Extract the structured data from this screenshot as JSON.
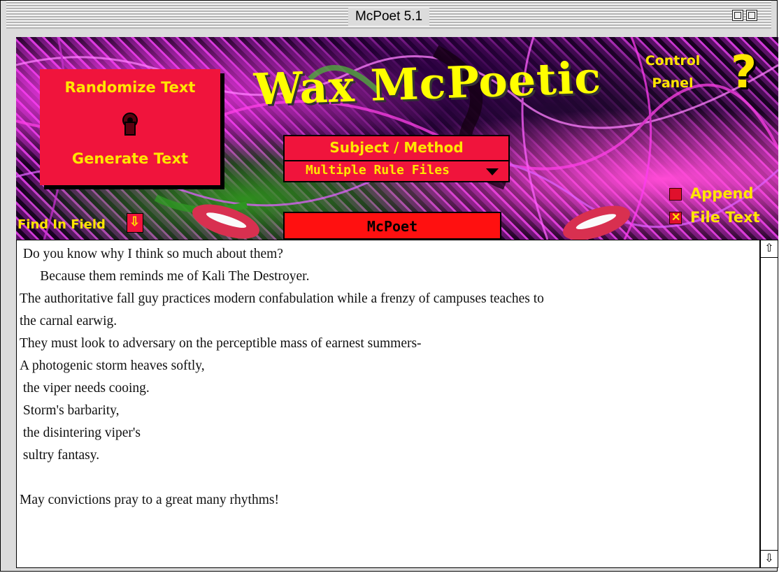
{
  "window": {
    "title": "McPoet 5.1"
  },
  "banner": {
    "app_title": "Wax McPoetic",
    "randomize_label": "Randomize Text",
    "generate_label": "Generate Text",
    "control_panel_label": "Control\nPanel",
    "help_label": "?",
    "subject_label": "Subject / Method",
    "method_selected": "Multiple Rule Files",
    "append_label": "Append",
    "append_checked": false,
    "file_text_label": "File Text",
    "file_text_checked": true,
    "find_label": "Find In Field",
    "mcpoet_label": "McPoet"
  },
  "poem": {
    "text": " Do you know why I think so much about them?\n      Because them reminds me of Kali The Destroyer.\nThe authoritative fall guy practices modern confabulation while a frenzy of campuses teaches to\nthe carnal earwig.\nThey must look to adversary on the perceptible mass of earnest summers-\nA photogenic storm heaves softly,\n the viper needs cooing.\n Storm's barbarity,\n the disintering viper's\n sultry fantasy.\n\nMay convictions pray to a great many rhythms!"
  },
  "icons": {
    "scroll_up": "⇧",
    "scroll_down": "⇩",
    "find_arrow": "⇩"
  }
}
